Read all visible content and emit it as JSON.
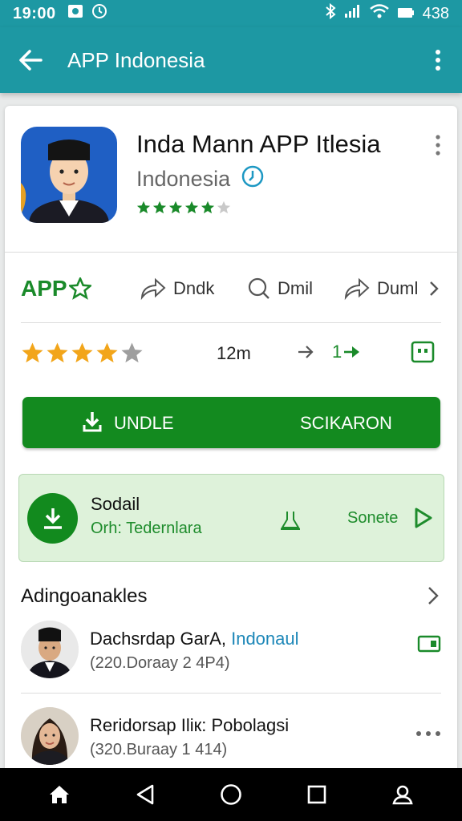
{
  "status_bar": {
    "time": "19:00",
    "battery": "438"
  },
  "app_bar": {
    "title": "APP Indonesia"
  },
  "app": {
    "title": "Inda Mann APP Itlesia",
    "subtitle": "Indonesia",
    "rating": 4.5
  },
  "actions": {
    "brand_label": "APP",
    "items": [
      {
        "label": "Dndk"
      },
      {
        "label": "Dmil"
      },
      {
        "label": "Duml"
      }
    ]
  },
  "stats": {
    "stars_filled": 4,
    "size": "12m",
    "count": "1"
  },
  "install_button": {
    "label_left": "UNDLE",
    "label_right": "SCIKARON"
  },
  "download_panel": {
    "title": "Sodail",
    "subtitle": "Orh: Tedernlara",
    "more_label": "Sonete"
  },
  "section": {
    "title": "Adingoanakles"
  },
  "developers": [
    {
      "name": "Dachsrdap GarA,",
      "name_highlight": "Indonaul",
      "meta": "(220.Doraay 2 4P4)"
    },
    {
      "name": "Reridorsap Iliк: Pobolagsi",
      "meta": "(320.Buraay 1 414)"
    }
  ],
  "colors": {
    "teal": "#1d98a3",
    "green": "#138a1f",
    "star": "#f2a51a",
    "panel_bg": "#def2da"
  }
}
